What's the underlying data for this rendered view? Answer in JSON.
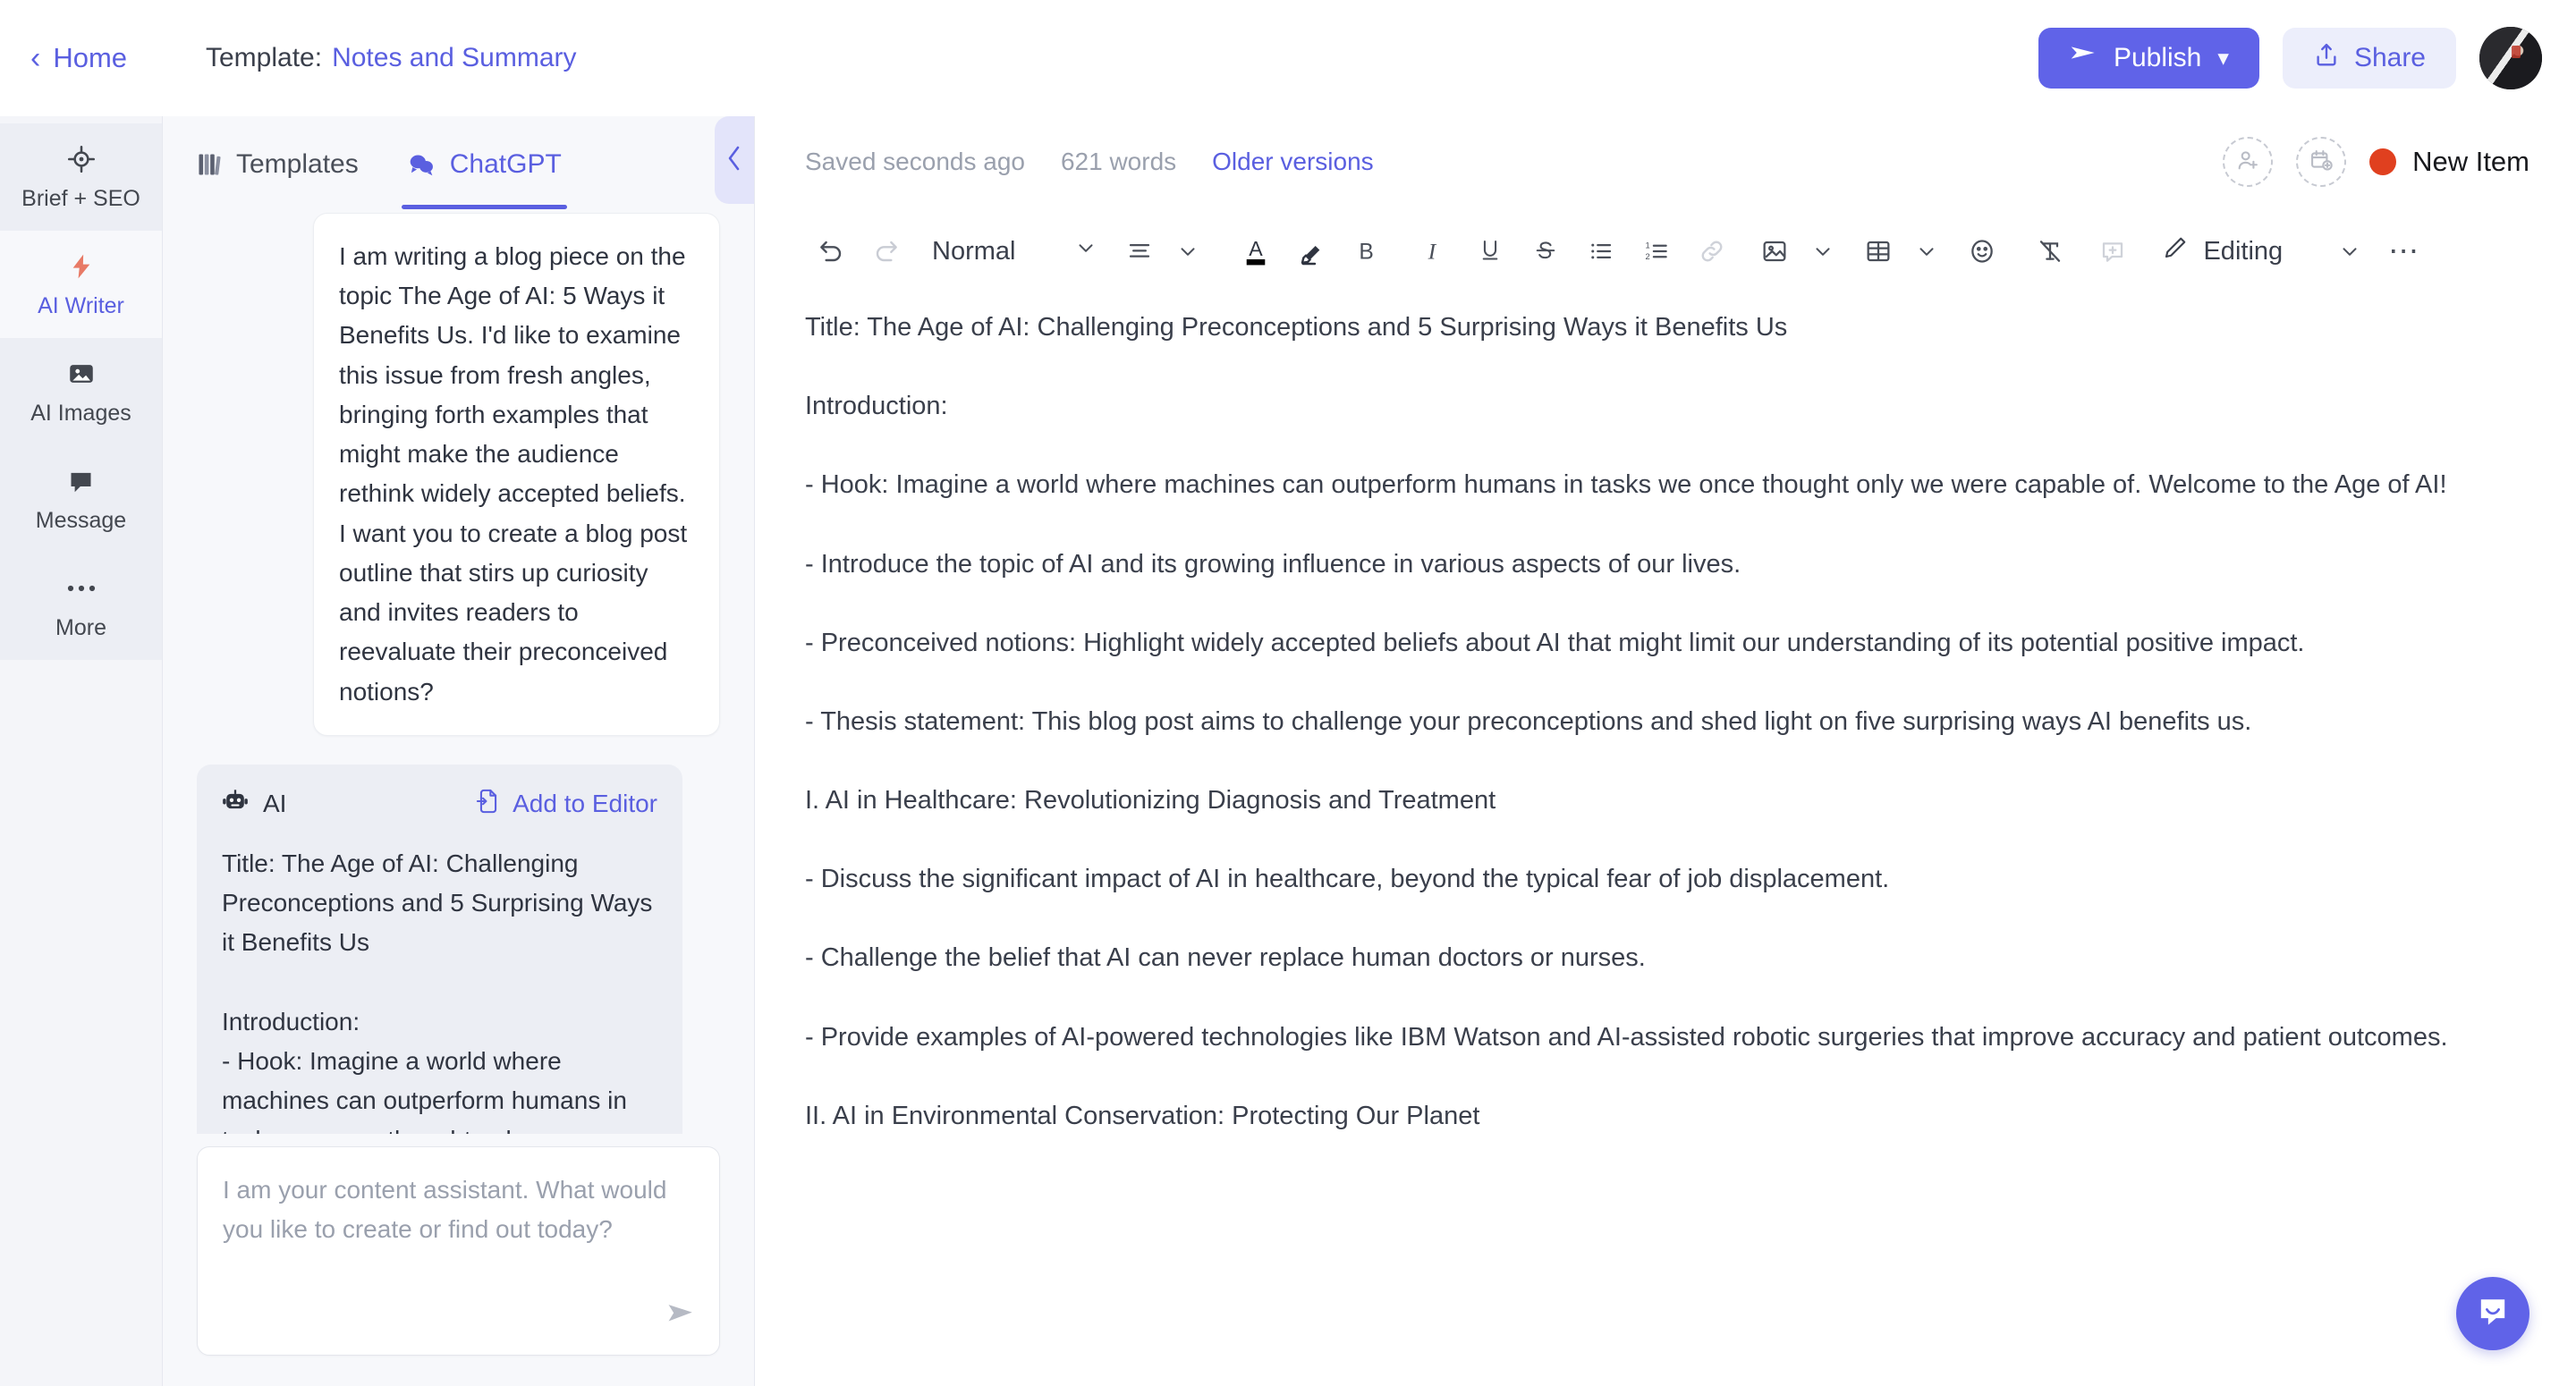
{
  "topbar": {
    "home_label": "Home",
    "template_prefix": "Template:",
    "template_name": "Notes and Summary",
    "publish_label": "Publish",
    "share_label": "Share",
    "accent_color": "#6063e8"
  },
  "rail": {
    "items": [
      {
        "label": "Brief + SEO",
        "icon": "target-icon",
        "active": false
      },
      {
        "label": "AI Writer",
        "icon": "lightning-icon",
        "active": true
      },
      {
        "label": "AI Images",
        "icon": "image-icon",
        "active": false
      },
      {
        "label": "Message",
        "icon": "chat-bubble-icon",
        "active": false
      },
      {
        "label": "More",
        "icon": "ellipsis-icon",
        "active": false
      }
    ]
  },
  "assistant": {
    "tabs": [
      {
        "label": "Templates",
        "icon": "books-icon",
        "active": false
      },
      {
        "label": "ChatGPT",
        "icon": "chat-bubbles-icon",
        "active": true
      }
    ],
    "user_message": "I am writing a blog piece on the topic The Age of AI: 5 Ways it Benefits Us. I'd like to examine this issue from fresh angles, bringing forth examples that might make the audience rethink widely accepted beliefs. I want you to create a blog post outline that stirs up curiosity and invites readers to reevaluate their preconceived notions?",
    "ai_label": "AI",
    "add_to_editor_label": "Add to Editor",
    "ai_message": "Title: The Age of AI: Challenging Preconceptions and 5 Surprising Ways it Benefits Us\n\nIntroduction:\n- Hook: Imagine a world where machines can outperform humans in tasks we once thought only we were capable of. Welcome to the Age of AI!\n- Introduce the topic of AI and its growing influence in various aspects of our lives.\n- Preconceived notions: Highlight",
    "composer_placeholder": "I am your content assistant. What would you like to create or find out today?"
  },
  "editor": {
    "saved_status": "Saved seconds ago",
    "word_count": "621 words",
    "older_versions_label": "Older versions",
    "new_item_label": "New Item",
    "new_item_dot_color": "#e0401f",
    "toolbar": {
      "paragraph_style": "Normal",
      "mode_label": "Editing",
      "items": [
        "undo-icon",
        "redo-icon",
        "paragraph-style-dropdown",
        "align-dropdown",
        "text-color-icon",
        "highlighter-icon",
        "bold-icon",
        "italic-icon",
        "underline-icon",
        "strikethrough-icon",
        "bullet-list-icon",
        "numbered-list-icon",
        "link-icon",
        "image-dropdown",
        "table-dropdown",
        "emoji-icon",
        "clear-formatting-icon",
        "add-comment-icon",
        "editing-mode-dropdown",
        "more-options-icon"
      ]
    },
    "document": [
      "Title: The Age of AI: Challenging Preconceptions and 5 Surprising Ways it Benefits Us",
      "Introduction:",
      "- Hook: Imagine a world where machines can outperform humans in tasks we once thought only we were capable of. Welcome to the Age of AI!",
      "- Introduce the topic of AI and its growing influence in various aspects of our lives.",
      "- Preconceived notions: Highlight widely accepted beliefs about AI that might limit our understanding of its potential positive impact.",
      "- Thesis statement: This blog post aims to challenge your preconceptions and shed light on five surprising ways AI benefits us.",
      "I. AI in Healthcare: Revolutionizing Diagnosis and Treatment",
      "- Discuss the significant impact of AI in healthcare, beyond the typical fear of job displacement.",
      "- Challenge the belief that AI can never replace human doctors or nurses.",
      "- Provide examples of AI-powered technologies like IBM Watson and AI-assisted robotic surgeries that improve accuracy and patient outcomes.",
      "II. AI in Environmental Conservation: Protecting Our Planet"
    ]
  },
  "support": {
    "icon": "intercom-chat-icon"
  }
}
